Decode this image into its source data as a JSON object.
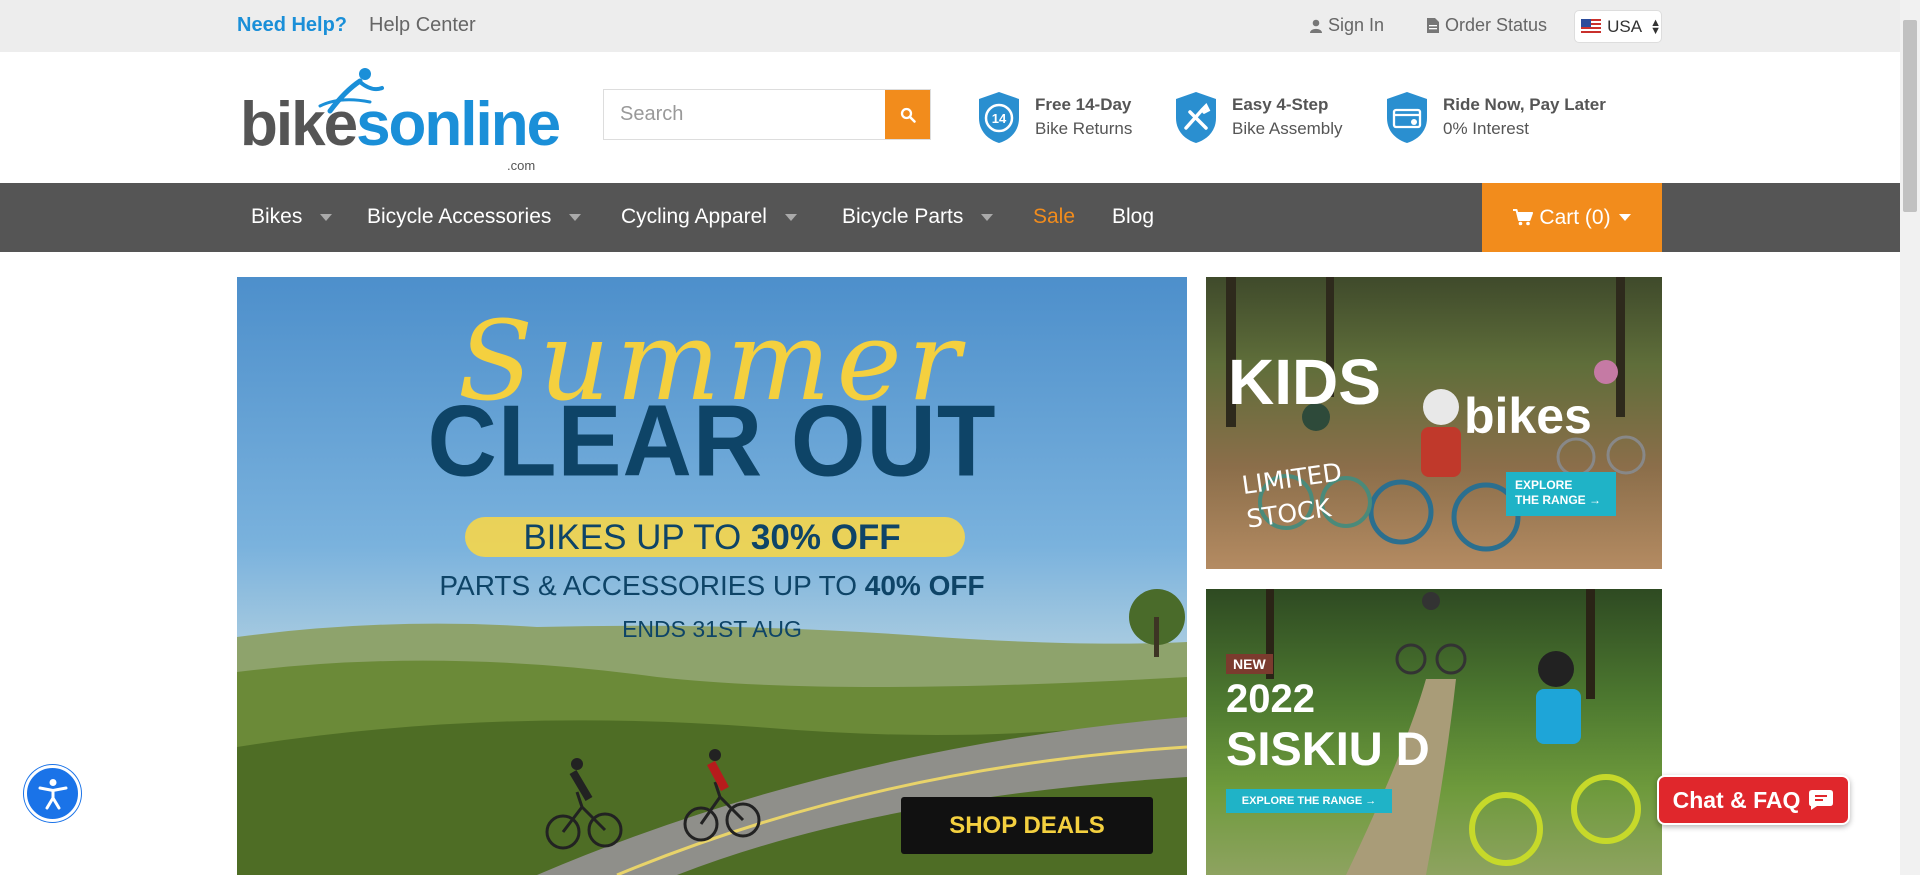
{
  "topbar": {
    "need_help": "Need Help?",
    "help_center": "Help Center",
    "sign_in": "Sign In",
    "order_status": "Order Status",
    "country": "USA"
  },
  "header": {
    "logo_main_left": "bike",
    "logo_main_right": "sonline",
    "logo_suffix": ".com",
    "search_placeholder": "Search",
    "features": [
      {
        "title": "Free 14-Day",
        "subtitle": "Bike Returns",
        "icon": "returns-14-icon",
        "badge_text": "14"
      },
      {
        "title": "Easy 4-Step",
        "subtitle": "Bike Assembly",
        "icon": "tools-icon"
      },
      {
        "title": "Ride Now, Pay Later",
        "subtitle": "0% Interest",
        "icon": "payment-card-icon"
      }
    ]
  },
  "nav": {
    "items": [
      {
        "label": "Bikes",
        "dropdown": true
      },
      {
        "label": "Bicycle Accessories",
        "dropdown": true
      },
      {
        "label": "Cycling Apparel",
        "dropdown": true
      },
      {
        "label": "Bicycle Parts",
        "dropdown": true
      },
      {
        "label": "Sale",
        "dropdown": false
      },
      {
        "label": "Blog",
        "dropdown": false
      }
    ],
    "cart_label": "Cart (0)"
  },
  "hero": {
    "script_title": "Summer",
    "title": "CLEAR OUT",
    "line1_prefix": "BIKES UP TO ",
    "line1_bold": "30% OFF",
    "line2_prefix": "PARTS & ACCESSORIES UP TO ",
    "line2_bold": "40% OFF",
    "line3": "ENDS 31ST AUG",
    "cta": "SHOP DEALS"
  },
  "kids_banner": {
    "title": "KIDS",
    "subtitle": "bikes",
    "badge_line1": "LIMITED",
    "badge_line2": "STOCK",
    "cta_line1": "EXPLORE",
    "cta_line2": "THE RANGE →"
  },
  "siskiu_banner": {
    "tag": "NEW",
    "year": "2022",
    "name": "SISKIU D",
    "cta": "EXPLORE THE RANGE →"
  },
  "chat_label": "Chat & FAQ",
  "colors": {
    "brand_blue": "#1a8fd8",
    "accent_orange": "#f28c1c",
    "nav_gray": "#555555",
    "chat_red": "#e0272c"
  }
}
